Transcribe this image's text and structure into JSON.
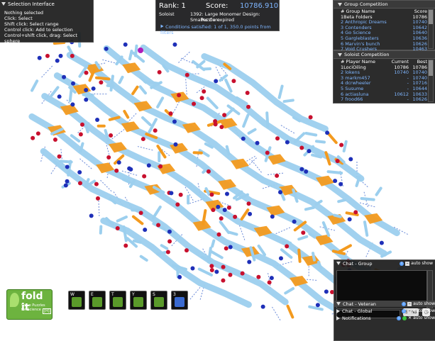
{
  "selection": {
    "title": "Selection Interface",
    "lines": [
      "Nothing selected",
      "Click: Select",
      "Shift click: Select range",
      "Control click: Add to selection",
      "Control+shift click, drag: Select sphere"
    ]
  },
  "score": {
    "rank_label": "Rank: 1",
    "score_label": "Score:",
    "score_value": "10786.910",
    "mode": "Soloist",
    "puzzle": "1392: Large Monomer Design: Smaller Core",
    "status": "Puzzle expired",
    "conditions": "Conditions satisfied: 1 of 1, 350.0 points from filters"
  },
  "group_competition": {
    "title": "Group Competition",
    "headers": {
      "name": "# Group Name",
      "score": "Score"
    },
    "rows": [
      {
        "name": "1Beta Folders",
        "score": "10786"
      },
      {
        "name": "2 Anthropic Dreams",
        "score": "10740"
      },
      {
        "name": "3 Contenders",
        "score": "10642"
      },
      {
        "name": "4 Go Science",
        "score": "10640"
      },
      {
        "name": "5 Gargleblasters",
        "score": "10636"
      },
      {
        "name": "6 Marvin's bunch",
        "score": "10626"
      },
      {
        "name": "7 Void Crushers",
        "score": "10463"
      }
    ]
  },
  "soloist_competition": {
    "title": "Soloist Competition",
    "headers": {
      "name": "# Player Name",
      "current": "Current",
      "best": "Best"
    },
    "rows": [
      {
        "name": "1LociOiling",
        "current": "10786",
        "best": "10786"
      },
      {
        "name": "2 lokens",
        "current": "10740",
        "best": "10740"
      },
      {
        "name": "3 markm457",
        "current": "-",
        "best": "10740"
      },
      {
        "name": "4 dcrwheeler",
        "current": "-",
        "best": "10716"
      },
      {
        "name": "5 Susume",
        "current": "-",
        "best": "10644"
      },
      {
        "name": "6 actiasluna",
        "current": "10612",
        "best": "10633"
      },
      {
        "name": "7 frood66",
        "current": "-",
        "best": "10626"
      }
    ]
  },
  "chat": {
    "group_title": "Chat - Group",
    "auto_show": "auto show",
    "send_label": "Send",
    "veteran_title": "Chat - Veteran",
    "global_title": "Chat - Global",
    "notifications_title": "Notifications"
  },
  "logo": {
    "word": "fold it",
    "tagline_1": "Solve Puzzles",
    "tagline_2": "for Science",
    "badge": "[H]"
  },
  "toolbar": [
    {
      "key": "W",
      "icon": "wiggle-icon",
      "color": "#5a9a2a"
    },
    {
      "key": "E",
      "icon": "shake-icon",
      "color": "#5a9a2a"
    },
    {
      "key": "T",
      "icon": "undo-icon",
      "color": "#5a9a2a"
    },
    {
      "key": "Y",
      "icon": "rebuild-icon",
      "color": "#5a9a2a"
    },
    {
      "key": "S",
      "icon": "mutate-icon",
      "color": "#5a9a2a"
    },
    {
      "key": "3",
      "icon": "move-icon",
      "color": "#3a6ad0"
    }
  ],
  "colors": {
    "sheet": "#f39a1e",
    "helix": "#9ccfee",
    "oxygen": "#c8102e",
    "nitrogen": "#1e2fb8",
    "hbond": "#6a8ad8",
    "accent_blue": "#7fb6ff"
  }
}
